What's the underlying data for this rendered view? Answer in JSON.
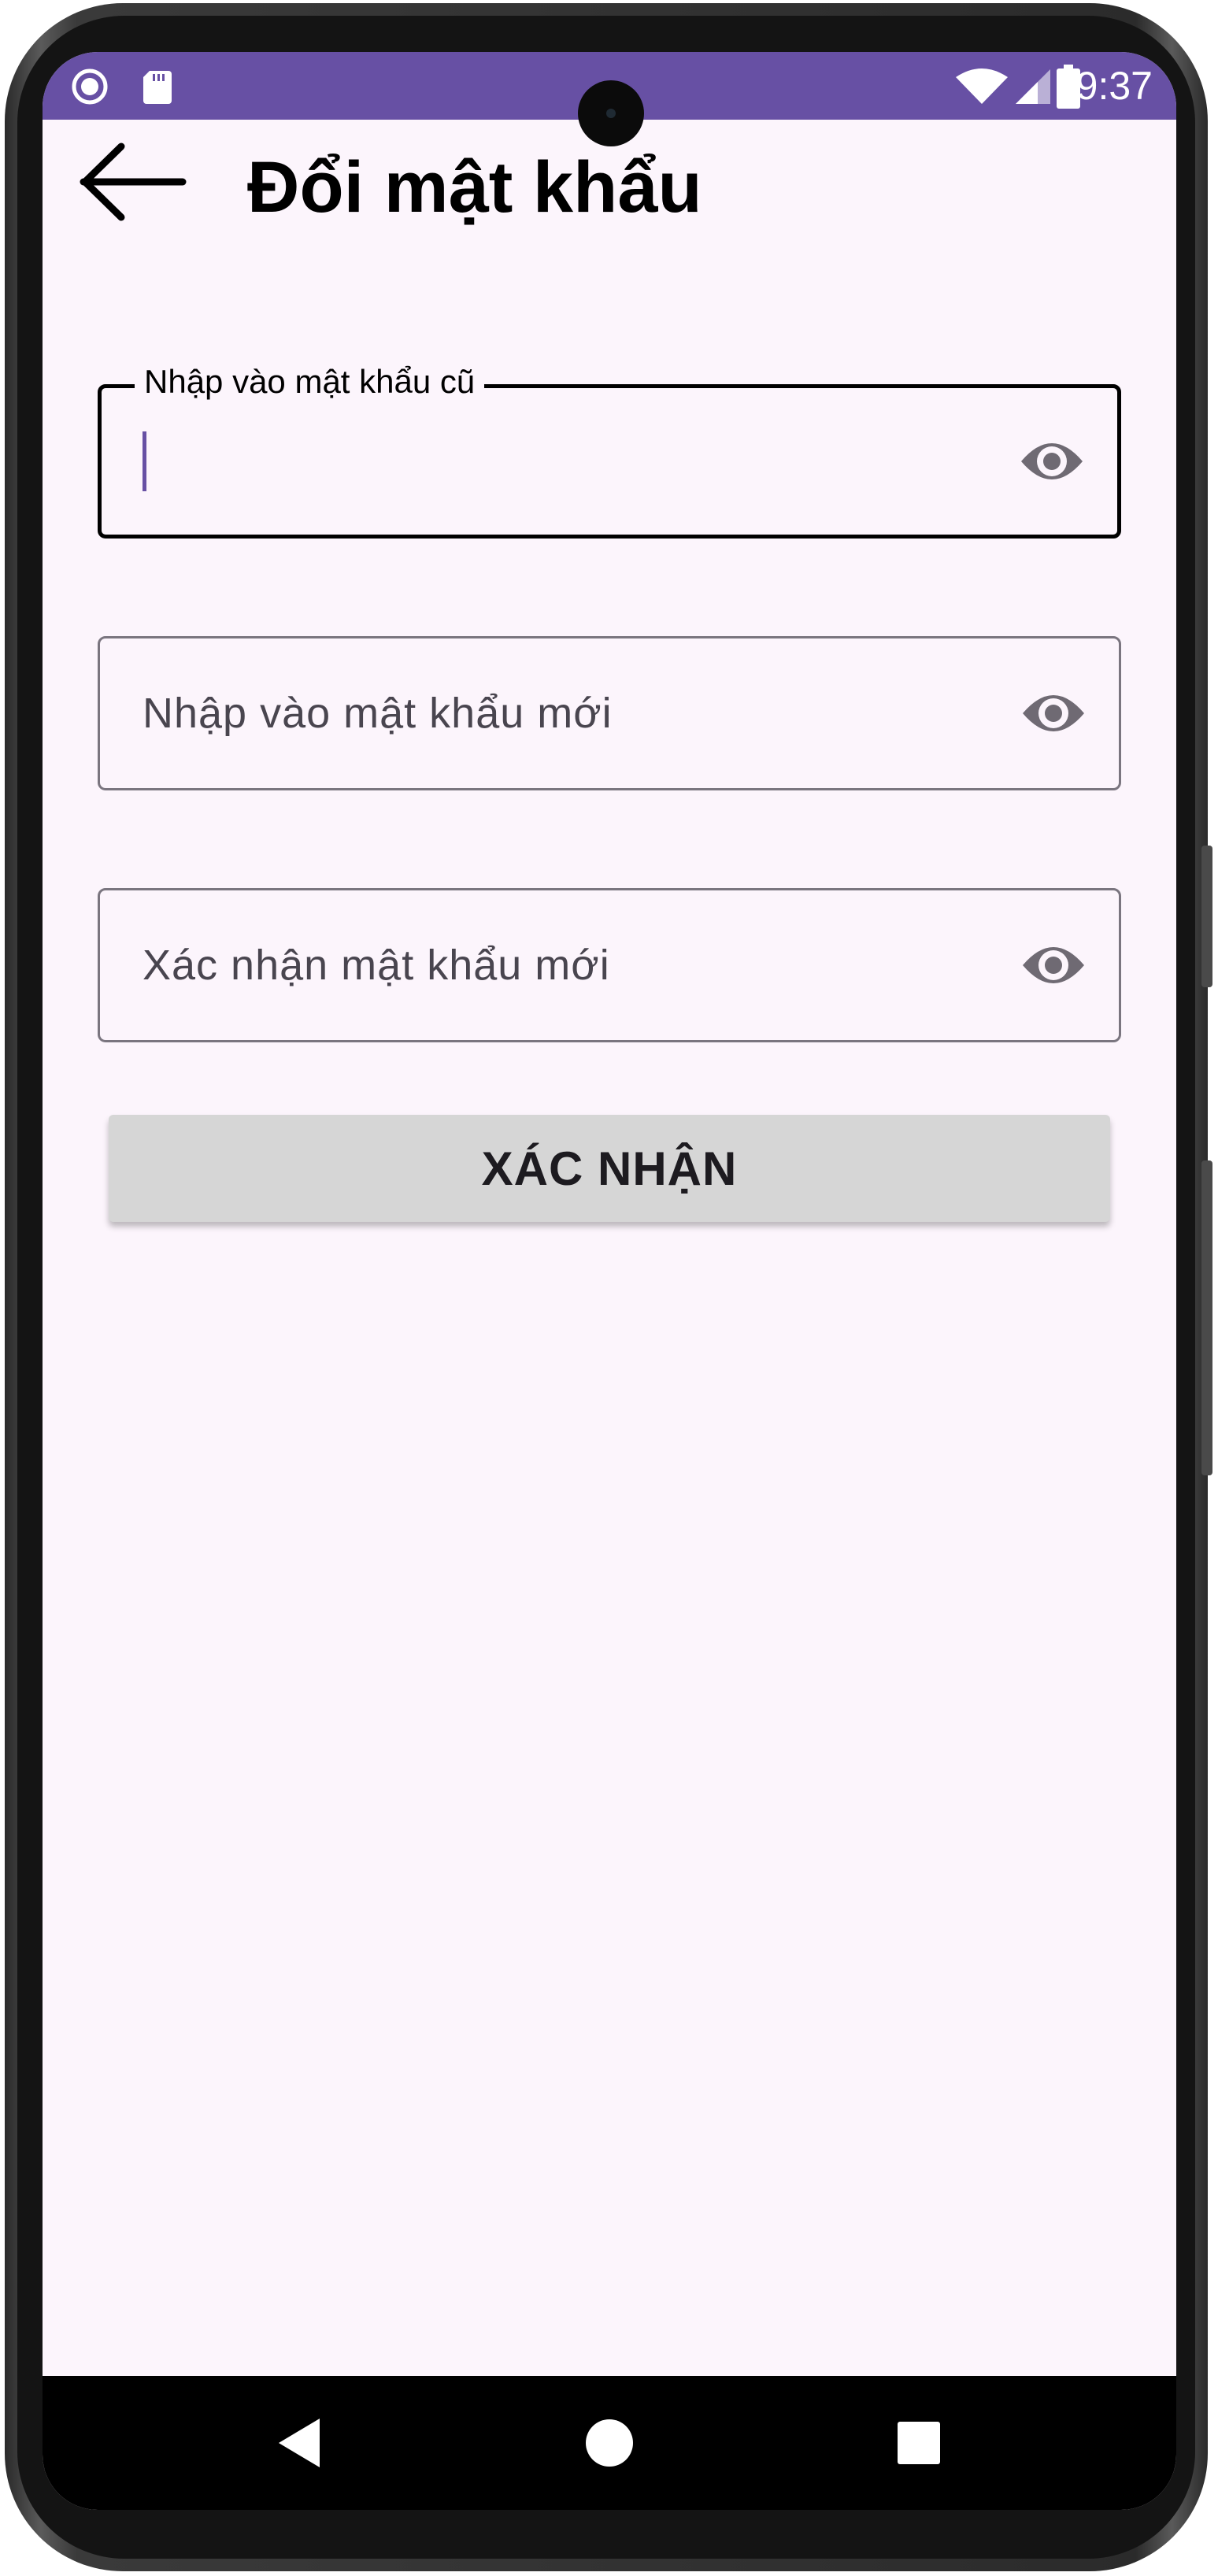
{
  "status_bar": {
    "time": "9:37",
    "icons": [
      "record-icon",
      "sd-card-icon",
      "wifi-icon",
      "signal-icon",
      "battery-icon"
    ],
    "background_color": "#6750a4"
  },
  "app_bar": {
    "title": "Đổi mật khẩu",
    "back_icon": "arrow-back-icon"
  },
  "form": {
    "old_password": {
      "label": "Nhập vào mật khẩu cũ",
      "value": "",
      "focused": true,
      "visibility_icon": "eye-icon"
    },
    "new_password": {
      "placeholder": "Nhập vào mật khẩu mới",
      "value": "",
      "visibility_icon": "eye-icon"
    },
    "confirm_password": {
      "placeholder": "Xác nhận mật khẩu mới",
      "value": "",
      "visibility_icon": "eye-icon"
    },
    "submit_label": "XÁC NHẬN"
  },
  "navigation_bar": {
    "buttons": [
      "back-triangle-icon",
      "home-circle-icon",
      "recents-square-icon"
    ]
  },
  "colors": {
    "accent": "#6750a4",
    "surface": "#fcf5fc",
    "button": "#d6d6d6"
  }
}
